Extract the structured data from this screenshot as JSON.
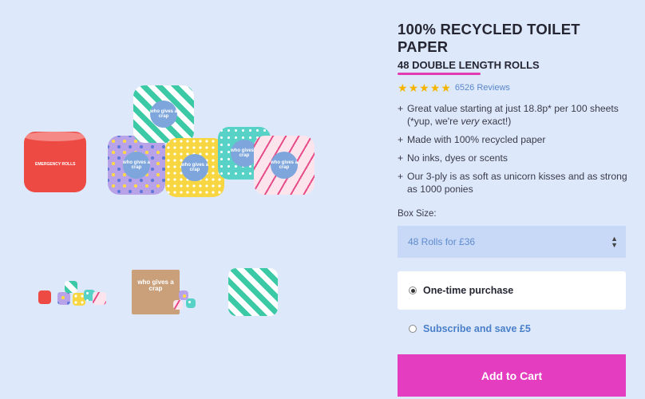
{
  "product": {
    "title": "100% RECYCLED TOILET PAPER",
    "subtitle": "48 DOUBLE LENGTH ROLLS",
    "rating": {
      "stars": 5,
      "reviews_text": "6526 Reviews"
    },
    "features": [
      {
        "line1": "Great value starting at just 18.8p* per 100 sheets",
        "line2_pre": "(*yup, we're ",
        "line2_em": "very",
        "line2_post": " exact!)"
      },
      {
        "line1": "Made with 100% recycled paper"
      },
      {
        "line1": "No inks, dyes or scents"
      },
      {
        "line1": "Our 3-ply is as soft as unicorn kisses and as strong",
        "line2_pre": "as 1000 ponies"
      }
    ],
    "box_size": {
      "label": "Box Size:",
      "selected": "48 Rolls for £36"
    },
    "purchase_options": {
      "one_time": "One-time purchase",
      "subscribe": "Subscribe and save £5",
      "selected": "one_time"
    },
    "add_to_cart": "Add to Cart"
  },
  "gallery": {
    "roll_label_text": "who gives a crap",
    "emergency_label": "EMERGENCY ROLLS",
    "box_text": "who gives a crap"
  },
  "colors": {
    "background": "#dde9fb",
    "accent_pink": "#e53dc0",
    "link_blue": "#5a86c9",
    "star": "#f5b400",
    "select_bg": "#c7d9f6"
  }
}
